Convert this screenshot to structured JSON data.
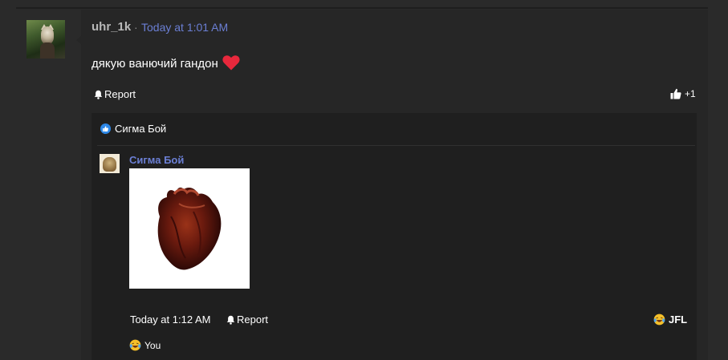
{
  "post": {
    "username": "uhr_1k",
    "separator": "·",
    "timestamp": "Today at 1:01 AM",
    "message": "дякую ванючий гандон",
    "report_label": "Report",
    "likes": "+1",
    "colors": {
      "link": "#6b7fd4",
      "heart": "#e8283c",
      "background": "#262626"
    }
  },
  "reply_thread": {
    "reactors_label": "Сигма Бой",
    "reply": {
      "author": "Сигма Бой",
      "timestamp": "Today at 1:12 AM",
      "report_label": "Report",
      "reaction_label": "JFL",
      "reacted_by": "You"
    }
  },
  "icons": {
    "bell": "bell-icon",
    "thumbs_up": "thumbs-up-icon",
    "laugh_cry": "laughing-crying-emoji-icon",
    "heart": "heart-emoji-icon"
  }
}
